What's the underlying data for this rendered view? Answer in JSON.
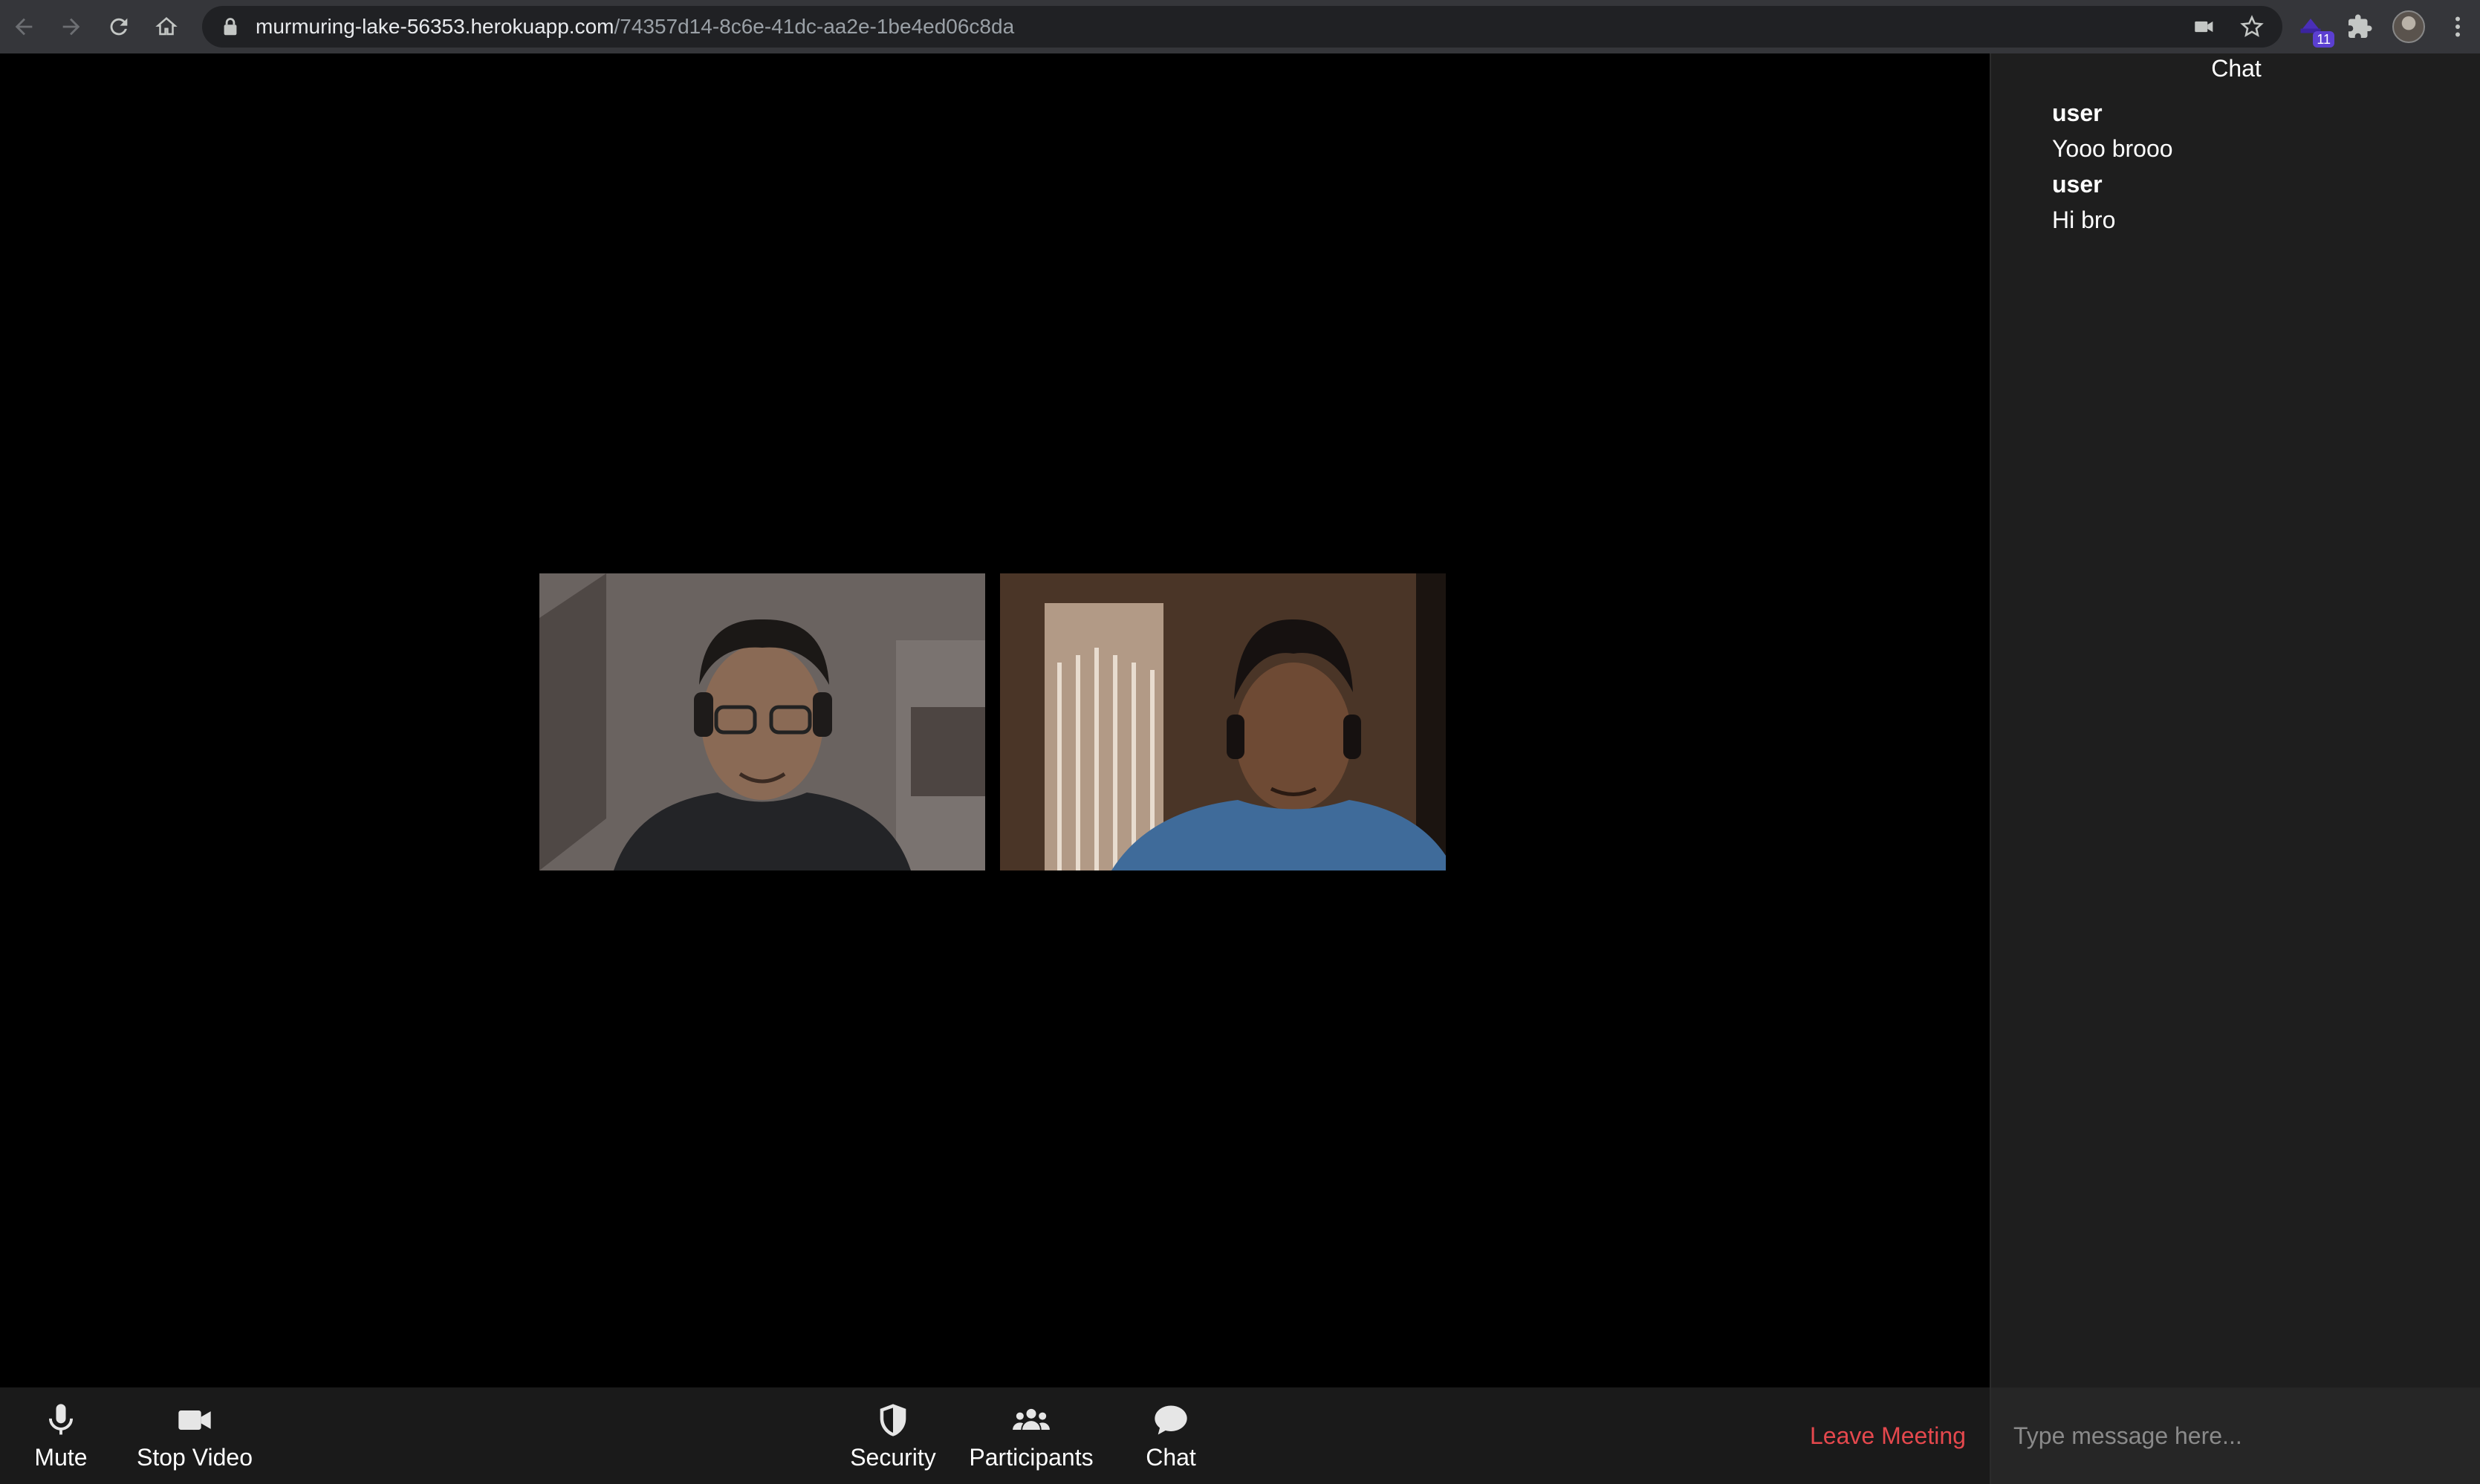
{
  "browser": {
    "url_host": "murmuring-lake-56353.herokuapp.com",
    "url_path": "/74357d14-8c6e-41dc-aa2e-1be4ed06c8da",
    "extension_badge": "11"
  },
  "toolbar": {
    "mute_label": "Mute",
    "stop_video_label": "Stop Video",
    "security_label": "Security",
    "participants_label": "Participants",
    "chat_label": "Chat",
    "leave_label": "Leave Meeting"
  },
  "chat": {
    "title": "Chat",
    "messages": [
      {
        "user": "user",
        "text": "Yooo brooo"
      },
      {
        "user": "user",
        "text": "Hi bro"
      }
    ],
    "input_placeholder": "Type message here..."
  },
  "colors": {
    "leave": "#e5484d",
    "toolbar_bg": "#1a1a1a",
    "chat_bg": "#1e1e1e"
  }
}
